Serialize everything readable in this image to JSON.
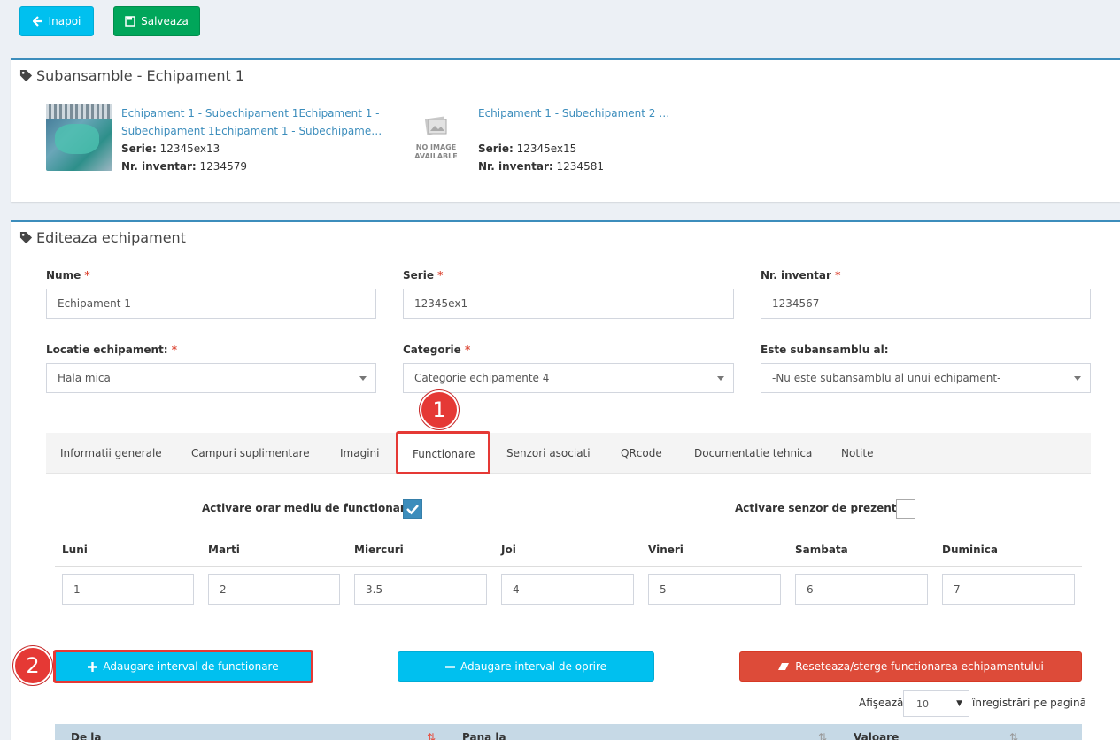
{
  "toolbar": {
    "back_label": "Inapoi",
    "save_label": "Salveaza"
  },
  "subassemblies": {
    "title": "Subansamble - Echipament 1",
    "items": [
      {
        "name_line1": "Echipament 1 - Subechipament 1Echipament 1 -",
        "name_line2": "Subechipament 1Echipament 1 - Subechipame…",
        "serie_label": "Serie:",
        "serie": "12345ex13",
        "inv_label": "Nr. inventar:",
        "inv": "1234579"
      },
      {
        "name_line1": "Echipament 1 - Subechipament 2 …",
        "no_image_line1": "NO IMAGE",
        "no_image_line2": "AVAILABLE",
        "serie_label": "Serie:",
        "serie": "12345ex15",
        "inv_label": "Nr. inventar:",
        "inv": "1234581"
      }
    ]
  },
  "edit": {
    "title": "Editeaza echipament",
    "nume_label": "Nume",
    "nume_value": "Echipament 1",
    "serie_label": "Serie",
    "serie_value": "12345ex1",
    "inv_label": "Nr. inventar",
    "inv_value": "1234567",
    "locatie_label": "Locatie echipament:",
    "locatie_value": "Hala mica",
    "categorie_label": "Categorie",
    "categorie_value": "Categorie echipamente 4",
    "sub_label": "Este subansamblu al:",
    "sub_value": "-Nu este subansamblu al unui echipament-",
    "required_mark": "*"
  },
  "tabs": [
    "Informatii generale",
    "Campuri suplimentare",
    "Imagini",
    "Functionare",
    "Senzori asociati",
    "QRcode",
    "Documentatie tehnica",
    "Notite"
  ],
  "functionare": {
    "orar_label": "Activare orar mediu de functionare:",
    "senzor_label": "Activare senzor de prezenta:",
    "days": [
      {
        "label": "Luni",
        "value": "1"
      },
      {
        "label": "Marti",
        "value": "2"
      },
      {
        "label": "Miercuri",
        "value": "3.5"
      },
      {
        "label": "Joi",
        "value": "4"
      },
      {
        "label": "Vineri",
        "value": "5"
      },
      {
        "label": "Sambata",
        "value": "6"
      },
      {
        "label": "Duminica",
        "value": "7"
      }
    ],
    "add_interval_label": "Adaugare interval de functionare",
    "add_stop_label": "Adaugare interval de oprire",
    "reset_label": "Reseteaza/sterge functionarea echipamentului",
    "show_label": "Afişează",
    "page_size": "10",
    "per_page_label": "înregistrări pe pagină",
    "columns": [
      "De la",
      "Pana la",
      "Valoare"
    ]
  },
  "annotations": {
    "one": "1",
    "two": "2"
  },
  "colors": {
    "info": "#00c0ef",
    "success": "#00a65a",
    "danger": "#dd4b39",
    "primary": "#3c8dbc",
    "annotation": "#e53935"
  }
}
